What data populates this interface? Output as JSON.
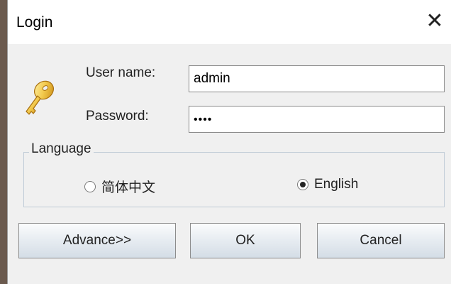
{
  "window": {
    "title": "Login",
    "close_symbol": "✕"
  },
  "form": {
    "username_label": "User name:",
    "username_value": "admin",
    "password_label": "Password:",
    "password_value": "••••"
  },
  "language": {
    "legend": "Language",
    "options": [
      {
        "label": "简体中文",
        "selected": false
      },
      {
        "label": "English",
        "selected": true
      }
    ]
  },
  "buttons": {
    "advance": "Advance>>",
    "ok": "OK",
    "cancel": "Cancel"
  },
  "icons": {
    "key": "key-icon",
    "close": "close-icon"
  }
}
